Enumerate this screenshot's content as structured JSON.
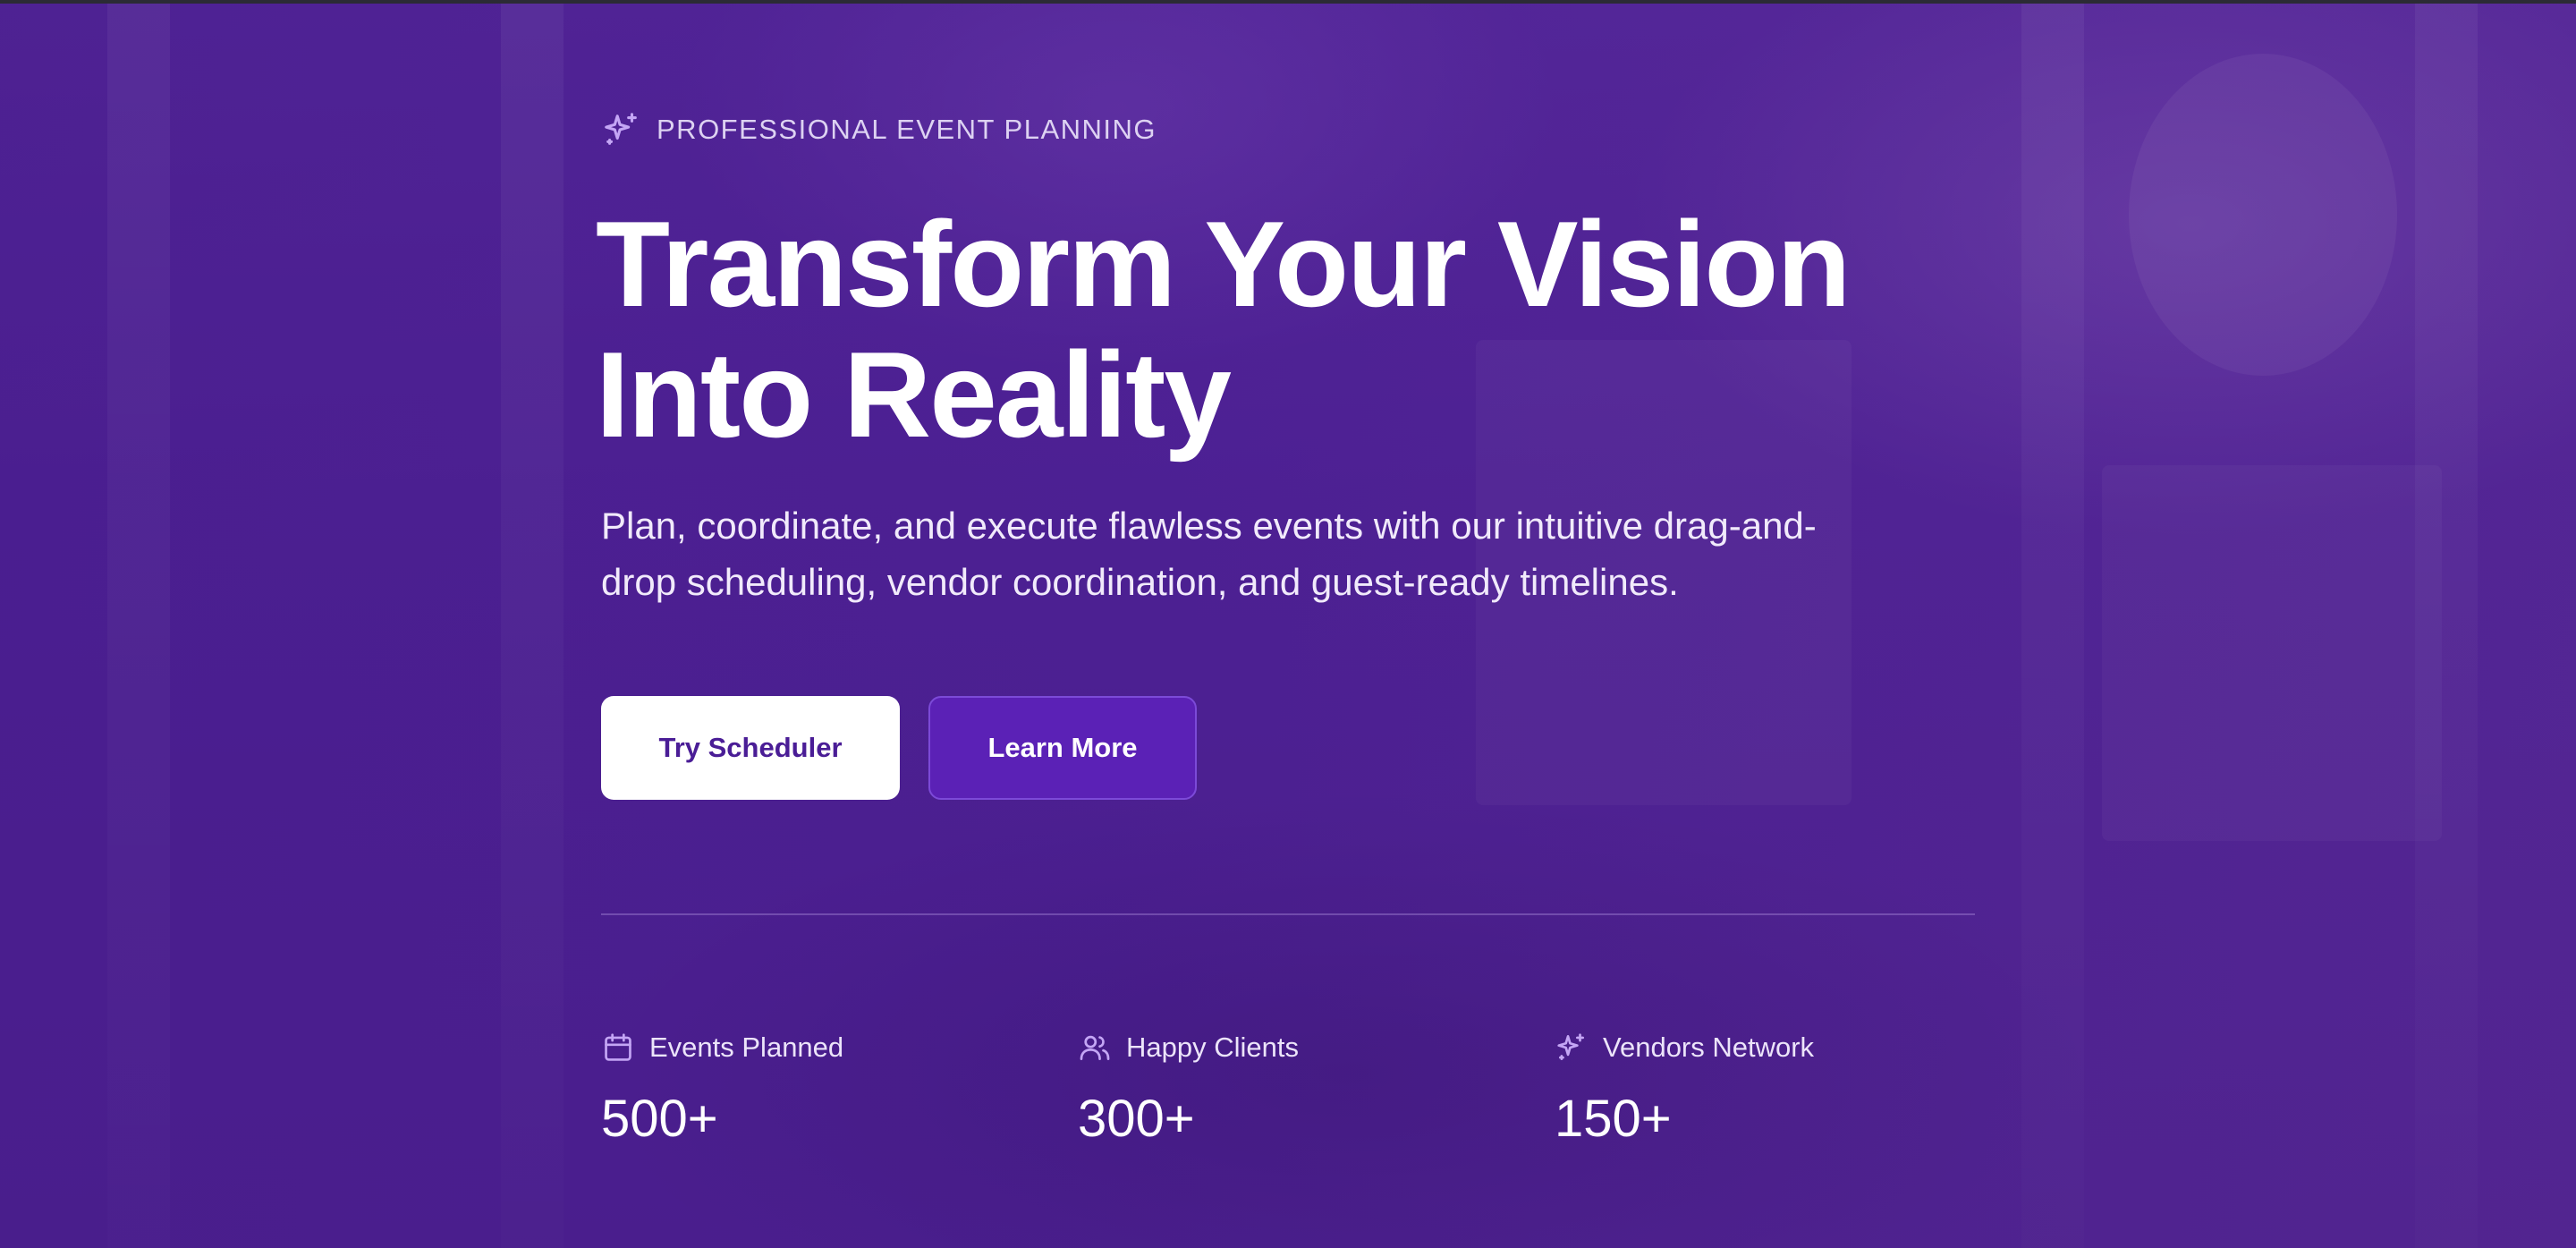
{
  "hero": {
    "eyebrow": "PROFESSIONAL EVENT PLANNING",
    "eyebrow_icon": "sparkles-icon",
    "headline_line1": "Transform Your Vision",
    "headline_line2": "Into Reality",
    "subtitle_line1": "Plan, coordinate, and execute flawless events with our intuitive drag-and-",
    "subtitle_line2": "drop scheduling, vendor coordination, and guest-ready timelines.",
    "primary_button": "Try Scheduler",
    "secondary_button": "Learn More"
  },
  "stats": [
    {
      "icon": "calendar-icon",
      "label": "Events Planned",
      "value": "500+"
    },
    {
      "icon": "users-icon",
      "label": "Happy Clients",
      "value": "300+"
    },
    {
      "icon": "sparkles-icon",
      "label": "Vendors Network",
      "value": "150+"
    }
  ],
  "colors": {
    "background": "#4a1f8c",
    "accent": "#5b21b6",
    "primary_button_bg": "#ffffff",
    "primary_button_text": "#4a1d96",
    "icon_tint": "#c4a6f5"
  }
}
